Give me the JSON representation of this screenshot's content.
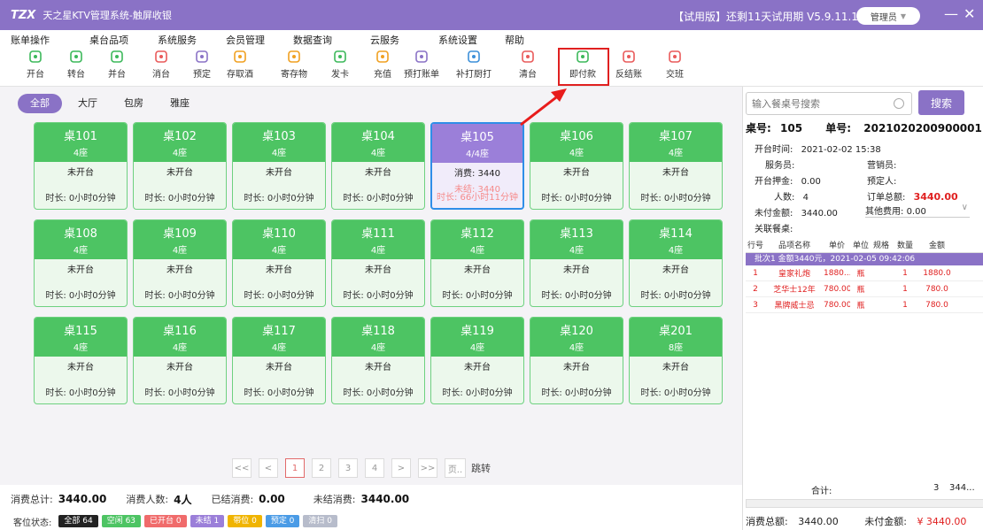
{
  "title": {
    "logo": "TZX",
    "app": "天之星KTV管理系统-触屏收银",
    "trial": "【试用版】还剩11天试用期 V5.9.11.19",
    "user": "管理员",
    "minimize": "—",
    "close": "✕"
  },
  "menu": [
    "账单操作",
    "桌台品项",
    "系统服务",
    "会员管理",
    "数据查询",
    "云服务",
    "系统设置",
    "帮助"
  ],
  "toolbar": [
    {
      "label": "开台",
      "icon": "play-icon",
      "color": "#3cb85a"
    },
    {
      "label": "转台",
      "icon": "transfer-icon",
      "color": "#3cb85a"
    },
    {
      "label": "并台",
      "icon": "merge-icon",
      "color": "#3cb85a"
    },
    {
      "label": "消台",
      "icon": "cancel-table-icon",
      "color": "#e95a5a"
    },
    {
      "label": "预定",
      "icon": "reserve-icon",
      "color": "#8a72c6"
    },
    {
      "label": "存取酒",
      "icon": "wine-icon",
      "color": "#f0a020"
    },
    {
      "label": "寄存物",
      "icon": "storage-icon",
      "color": "#f0a020"
    },
    {
      "label": "发卡",
      "icon": "card-icon",
      "color": "#3cb85a"
    },
    {
      "label": "充值",
      "icon": "recharge-icon",
      "color": "#f0a020"
    },
    {
      "label": "预打账单",
      "icon": "preprint-bill-icon",
      "color": "#8a72c6"
    },
    {
      "label": "补打厨打",
      "icon": "reprint-kitchen-icon",
      "color": "#3b8fd9"
    },
    {
      "label": "清台",
      "icon": "clear-table-icon",
      "color": "#e95a5a"
    },
    {
      "label": "即付款",
      "icon": "wallet-icon",
      "color": "#3cb85a"
    },
    {
      "label": "反结账",
      "icon": "reverse-checkout-icon",
      "color": "#e95a5a"
    },
    {
      "label": "交班",
      "icon": "handover-icon",
      "color": "#e95a5a"
    }
  ],
  "area_tabs": [
    "全部",
    "大厅",
    "包房",
    "雅座"
  ],
  "tables": [
    {
      "name": "桌101",
      "seats": "4座",
      "status": "未开台",
      "time": "时长: 0小时0分钟"
    },
    {
      "name": "桌102",
      "seats": "4座",
      "status": "未开台",
      "time": "时长: 0小时0分钟"
    },
    {
      "name": "桌103",
      "seats": "4座",
      "status": "未开台",
      "time": "时长: 0小时0分钟"
    },
    {
      "name": "桌104",
      "seats": "4座",
      "status": "未开台",
      "time": "时长: 0小时0分钟"
    },
    {
      "name": "桌105",
      "seats": "4/4座",
      "status": "消费: 3440",
      "extra": "未结: 3440",
      "time": "时长: 66小时11分钟",
      "active": true
    },
    {
      "name": "桌106",
      "seats": "4座",
      "status": "未开台",
      "time": "时长: 0小时0分钟"
    },
    {
      "name": "桌107",
      "seats": "4座",
      "status": "未开台",
      "time": "时长: 0小时0分钟"
    },
    {
      "name": "桌108",
      "seats": "4座",
      "status": "未开台",
      "time": "时长: 0小时0分钟"
    },
    {
      "name": "桌109",
      "seats": "4座",
      "status": "未开台",
      "time": "时长: 0小时0分钟"
    },
    {
      "name": "桌110",
      "seats": "4座",
      "status": "未开台",
      "time": "时长: 0小时0分钟"
    },
    {
      "name": "桌111",
      "seats": "4座",
      "status": "未开台",
      "time": "时长: 0小时0分钟"
    },
    {
      "name": "桌112",
      "seats": "4座",
      "status": "未开台",
      "time": "时长: 0小时0分钟"
    },
    {
      "name": "桌113",
      "seats": "4座",
      "status": "未开台",
      "time": "时长: 0小时0分钟"
    },
    {
      "name": "桌114",
      "seats": "4座",
      "status": "未开台",
      "time": "时长: 0小时0分钟"
    },
    {
      "name": "桌115",
      "seats": "4座",
      "status": "未开台",
      "time": "时长: 0小时0分钟"
    },
    {
      "name": "桌116",
      "seats": "4座",
      "status": "未开台",
      "time": "时长: 0小时0分钟"
    },
    {
      "name": "桌117",
      "seats": "4座",
      "status": "未开台",
      "time": "时长: 0小时0分钟"
    },
    {
      "name": "桌118",
      "seats": "4座",
      "status": "未开台",
      "time": "时长: 0小时0分钟"
    },
    {
      "name": "桌119",
      "seats": "4座",
      "status": "未开台",
      "time": "时长: 0小时0分钟"
    },
    {
      "name": "桌120",
      "seats": "4座",
      "status": "未开台",
      "time": "时长: 0小时0分钟"
    },
    {
      "name": "桌201",
      "seats": "8座",
      "status": "未开台",
      "time": "时长: 0小时0分钟"
    }
  ],
  "pager": {
    "first": "<<",
    "prev": "<",
    "pages": [
      "1",
      "2",
      "3",
      "4"
    ],
    "current": "1",
    "next": ">",
    "last": ">>",
    "page_input": "页..",
    "jump": "跳转"
  },
  "summary": {
    "total_label": "消费总计:",
    "total": "3440.00",
    "people_label": "消费人数:",
    "people": "4人",
    "settled_label": "已结消费:",
    "settled": "0.00",
    "unsettled_label": "未结消费:",
    "unsettled": "3440.00"
  },
  "status_bar": {
    "label": "客位状态:",
    "items": [
      {
        "text": "全部 64",
        "color": "#222222"
      },
      {
        "text": "空闲 63",
        "color": "#4dc463"
      },
      {
        "text": "已开台 0",
        "color": "#f06b6b"
      },
      {
        "text": "未结 1",
        "color": "#9b7fd9"
      },
      {
        "text": "带位 0",
        "color": "#f0b400"
      },
      {
        "text": "预定 0",
        "color": "#4a9be6"
      },
      {
        "text": "清扫 0",
        "color": "#b7bccb"
      }
    ]
  },
  "detail": {
    "search_placeholder": "输入餐桌号搜索",
    "search_btn": "搜索",
    "table_label": "桌号:",
    "table_no": "105",
    "order_label": "单号:",
    "order_no": "2021020200900001",
    "open_time_label": "开台时间:",
    "open_time": "2021-02-02 15:38",
    "waiter_label": "服务员:",
    "waiter": "",
    "sales_label": "营销员:",
    "sales": "",
    "deposit_label": "开台押金:",
    "deposit": "0.00",
    "booker_label": "预定人:",
    "booker": "",
    "people_label": "人数:",
    "people": "4",
    "order_total_label": "订单总额:",
    "order_total": "3440.00",
    "unpaid_label": "未付金额:",
    "unpaid": "3440.00",
    "other_fee_label": "其他费用:",
    "other_fee": "0.00",
    "linked_label": "关联餐桌:",
    "linked": ""
  },
  "items_grid": {
    "headers": [
      "行号",
      "品项名称",
      "单价",
      "单位",
      "规格",
      "数量",
      "金额"
    ],
    "batch": "批次1  金额3440元，2021-02-05 09:42:06",
    "rows": [
      {
        "no": "1",
        "name": "皇家礼炮",
        "price": "1880....",
        "unit": "瓶",
        "spec": "",
        "qty": "1",
        "amount": "1880.0"
      },
      {
        "no": "2",
        "name": "芝华士12年",
        "price": "780.00",
        "unit": "瓶",
        "spec": "",
        "qty": "1",
        "amount": "780.0"
      },
      {
        "no": "3",
        "name": "黑牌威士忌",
        "price": "780.00",
        "unit": "瓶",
        "spec": "",
        "qty": "1",
        "amount": "780.0"
      }
    ],
    "total_label": "合计:",
    "total_qty": "3",
    "total_amount": "344..."
  },
  "right_summary": {
    "total_label": "消费总额:",
    "total": "3440.00",
    "unpaid_label": "未付金额:",
    "unpaid": "¥ 3440.00"
  }
}
